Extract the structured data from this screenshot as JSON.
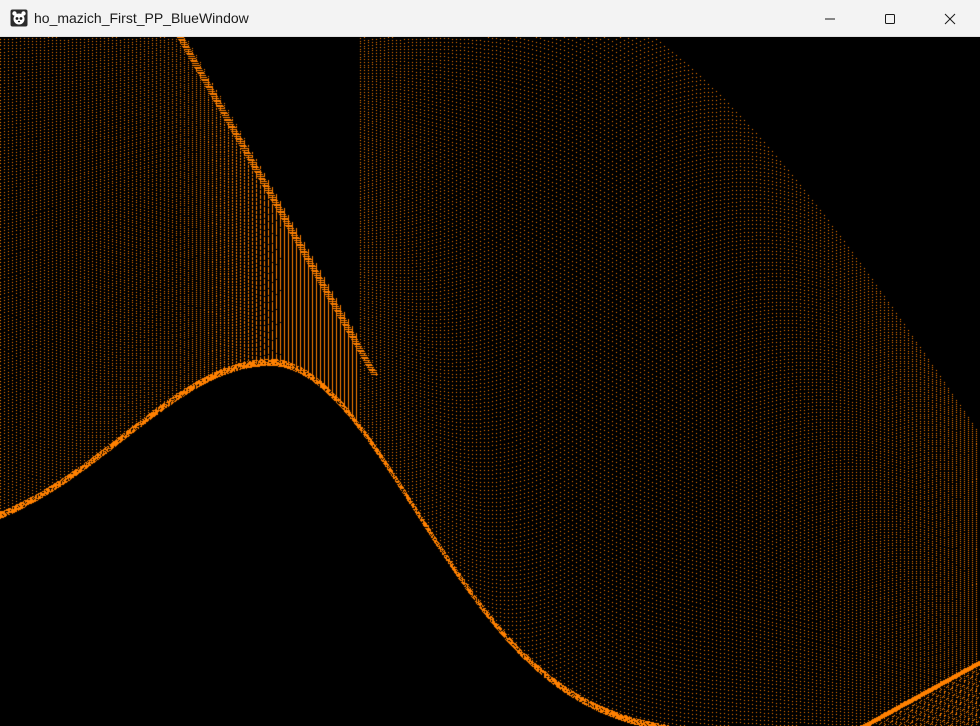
{
  "window": {
    "title": "ho_mazich_First_PP_BlueWindow",
    "app_icon": "panda-icon",
    "controls": {
      "minimize_icon": "minimize-icon",
      "maximize_icon": "maximize-icon",
      "close_icon": "close-icon"
    }
  },
  "canvas": {
    "background_color": "#000000",
    "dot_color": "#ff8000"
  }
}
